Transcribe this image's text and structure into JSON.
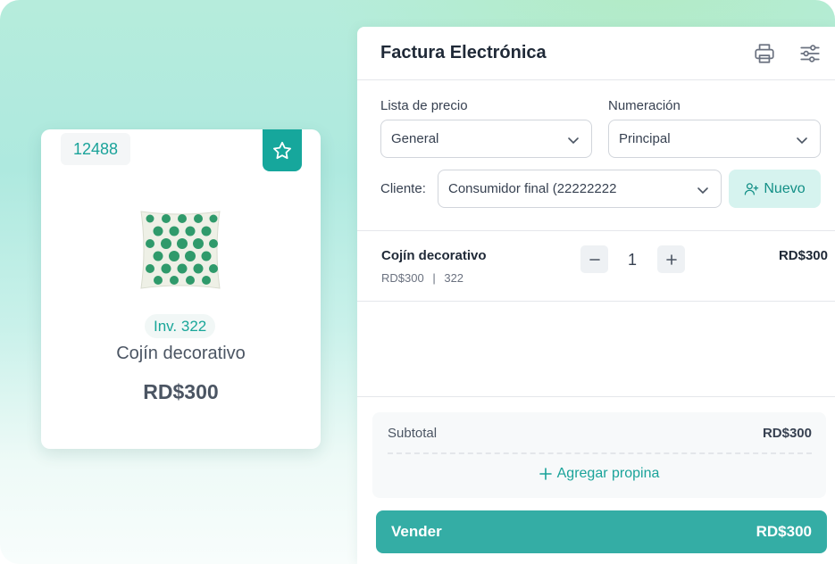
{
  "product_card": {
    "code": "12488",
    "inventory": "Inv. 322",
    "name": "Cojín decorativo",
    "price": "RD$300",
    "favorite_icon": "star-icon",
    "image": "pillow-image"
  },
  "invoice": {
    "title": "Factura Electrónica",
    "header_icons": [
      "printer-icon",
      "settings-sliders-icon"
    ],
    "price_list": {
      "label": "Lista de precio",
      "value": "General"
    },
    "numbering": {
      "label": "Numeración",
      "value": "Principal"
    },
    "client": {
      "label": "Cliente:",
      "value": "Consumidor final (22222222"
    },
    "new_button": {
      "label": "Nuevo",
      "icon": "add-user-icon"
    },
    "items": [
      {
        "name": "Cojín decorativo",
        "unit_price": "RD$300",
        "stock": "322",
        "quantity": "1",
        "total": "RD$300"
      }
    ],
    "subtotal": {
      "label": "Subtotal",
      "value": "RD$300"
    },
    "tip": {
      "label": "Agregar propina",
      "icon": "plus-icon"
    },
    "sell": {
      "label": "Vender",
      "total": "RD$300"
    }
  },
  "colors": {
    "accent": "#16a79c",
    "sell_button": "#34ada5",
    "new_button_bg": "#d6f3ef"
  }
}
